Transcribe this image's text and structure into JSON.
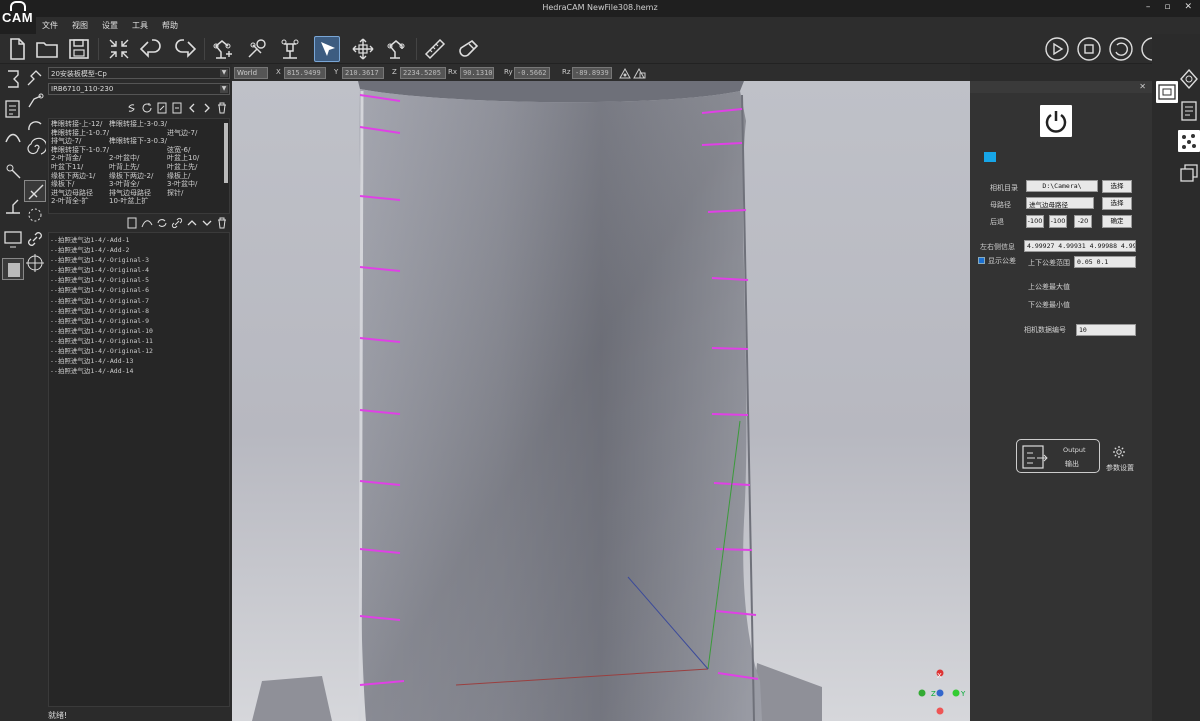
{
  "app": {
    "logo": "CAM",
    "window_title": "HedraCAM   NewFile308.hemz",
    "controls": [
      "–",
      "▫",
      "✕"
    ]
  },
  "menu": [
    "文件",
    "视图",
    "设置",
    "工具",
    "帮助"
  ],
  "toolbar": {
    "buttons": [
      "new-file",
      "open-file",
      "save-file",
      "fit-view",
      "undo",
      "redo",
      "robot-add",
      "robot-config",
      "robot-tool",
      "select-arrow",
      "move-gizmo",
      "robot-teach",
      "measure-ruler",
      "magnet-snap"
    ],
    "active": "select-arrow",
    "right_buttons": [
      "play",
      "stop",
      "loop",
      "power",
      "power-off"
    ]
  },
  "coordbar": {
    "frame": "World",
    "x_label": "X",
    "x": "815.9499",
    "y_label": "Y",
    "y": "210.3617",
    "z_label": "Z",
    "z": "2234.5205",
    "rx_label": "Rx",
    "rx": "90.1310",
    "ry_label": "Ry",
    "ry": "-0.5662",
    "rz_label": "Rz",
    "rz": "-89.8939"
  },
  "left_panel": {
    "model_select": "20安装板模型-Cp",
    "robot_select": "IRB6710_110-230",
    "paths": [
      [
        "榫眼转接-上-12/",
        "榫眼转接上-3-0.3/",
        ""
      ],
      [
        "榫眼转接上-1-0.7/",
        "",
        "进气边-7/"
      ],
      [
        "排气边-7/",
        "榫眼转接下-3-0.3/",
        ""
      ],
      [
        "榫眼转接下-1-0.7/",
        "",
        "弦宽-6/"
      ],
      [
        "2-叶背金/",
        "2-叶盆中/",
        "叶盆上10/"
      ],
      [
        "叶盆下11/",
        "叶背上先/",
        "叶盆上先/"
      ],
      [
        "缘板下两边-1/",
        "缘板下两边-2/",
        "缘板上/"
      ],
      [
        "缘板下/",
        "3-叶背全/",
        "3-叶盆中/"
      ],
      [
        "进气边母路径",
        "排气边母路径",
        "探针/"
      ],
      [
        "2-叶背全-扩",
        "10-叶盆上扩",
        ""
      ]
    ],
    "operations": [
      "拍照进气边1-4/-Add-1",
      "拍照进气边1-4/-Add-2",
      "拍照进气边1-4/-Original-3",
      "拍照进气边1-4/-Original-4",
      "拍照进气边1-4/-Original-5",
      "拍照进气边1-4/-Original-6",
      "拍照进气边1-4/-Original-7",
      "拍照进气边1-4/-Original-8",
      "拍照进气边1-4/-Original-9",
      "拍照进气边1-4/-Original-10",
      "拍照进气边1-4/-Original-11",
      "拍照进气边1-4/-Original-12",
      "拍照进气边1-4/-Add-13",
      "拍照进气边1-4/-Add-14"
    ],
    "status": "就绪!"
  },
  "right_panel": {
    "camera_dir_label": "相机目录",
    "camera_dir_value": "D:\\Camera\\",
    "select_btn_1": "选择",
    "mother_path_label": "母路径",
    "mother_path_value": "进气边母路径",
    "select_btn_2": "选择",
    "retreat_label": "后退",
    "retreat_values": [
      "-100",
      "-100",
      "-20"
    ],
    "confirm_btn": "确定",
    "lr_info_label": "左右侧信息",
    "lr_info_value": "4.99927 4.99931 4.99988 4.9998",
    "show_tolerance_label": "显示公差",
    "tolerance_range_label": "上下公差范围",
    "tolerance_range_value": "0.05 0.1",
    "upper_max_label": "上公差最大值",
    "lower_min_label": "下公差最小值",
    "camera_num_label": "相机数据编号",
    "camera_num_value": "10",
    "output_label_en": "Output",
    "output_label_cn": "输出",
    "settings_label": "参数设置",
    "accent": "#17a6e8"
  },
  "right_col": {
    "buttons": [
      "view-cube",
      "camera-frame",
      "report-doc",
      "scatter-points",
      "stacked-windows"
    ],
    "active": "camera-frame"
  },
  "axis_gizmo": {
    "x": "X",
    "y": "Y",
    "z": "Z"
  }
}
